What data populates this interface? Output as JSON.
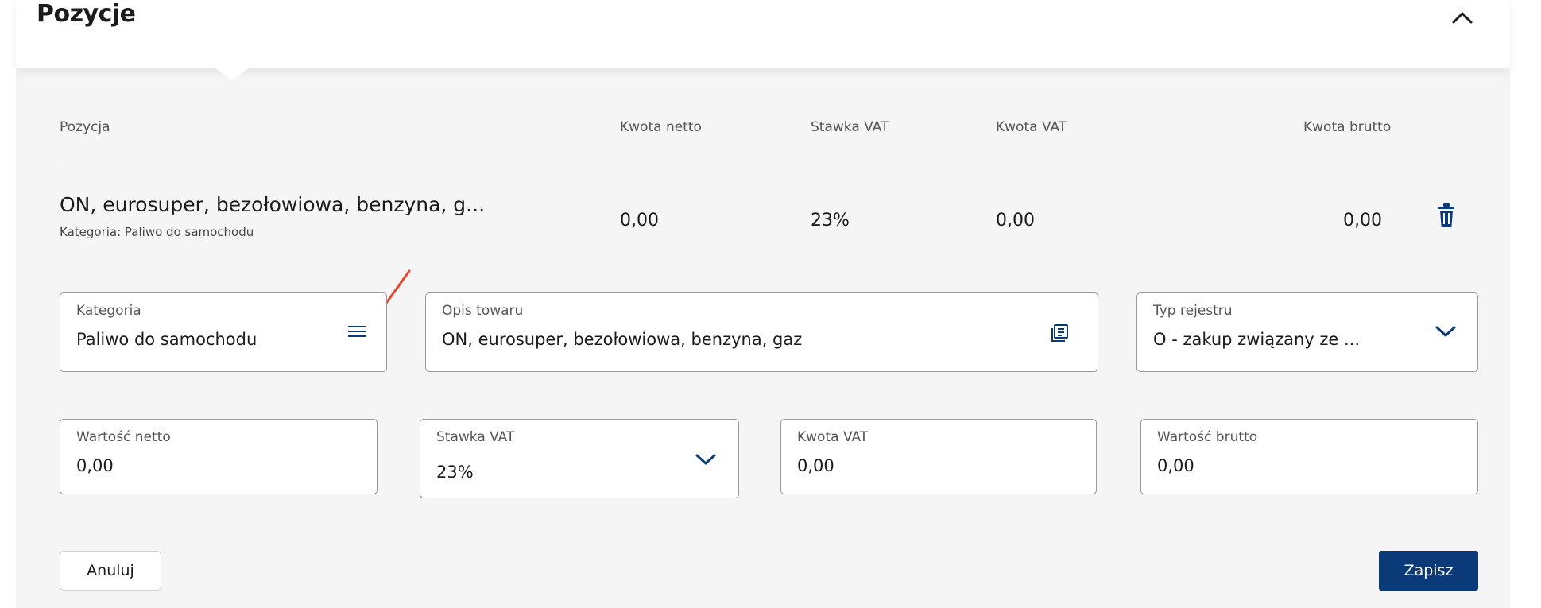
{
  "section": {
    "title": "Pozycje"
  },
  "table": {
    "headers": {
      "pozycja": "Pozycja",
      "kwota_netto": "Kwota netto",
      "stawka_vat": "Stawka VAT",
      "kwota_vat": "Kwota VAT",
      "kwota_brutto": "Kwota brutto"
    },
    "row": {
      "name": "ON, eurosuper, bezołowiowa, benzyna, g...",
      "category": "Kategoria: Paliwo do samochodu",
      "kwota_netto": "0,00",
      "stawka_vat": "23%",
      "kwota_vat": "0,00",
      "kwota_brutto": "0,00"
    }
  },
  "form": {
    "kategoria": {
      "label": "Kategoria",
      "value": "Paliwo do samochodu"
    },
    "opis_towaru": {
      "label": "Opis towaru",
      "value": "ON, eurosuper, bezołowiowa, benzyna, gaz"
    },
    "typ_rejestru": {
      "label": "Typ rejestru",
      "value": "O - zakup związany ze ..."
    },
    "wartosc_netto": {
      "label": "Wartość netto",
      "value": "0,00"
    },
    "stawka_vat": {
      "label": "Stawka VAT",
      "value": "23%"
    },
    "kwota_vat": {
      "label": "Kwota VAT",
      "value": "0,00"
    },
    "wartosc_brutto": {
      "label": "Wartość brutto",
      "value": "0,00"
    }
  },
  "actions": {
    "cancel_label": "Anuluj",
    "save_label": "Zapisz"
  },
  "icons": {
    "collapse": "chevron-up-icon",
    "delete": "trash-icon",
    "category_list": "menu-lines-icon",
    "description_dictionary": "dictionary-icon",
    "dropdown": "chevron-down-icon",
    "annotation": "red-arrow-icon"
  },
  "colors": {
    "primary": "#0a3a78",
    "accent_icon": "#0a3a78",
    "annotation": "#e8432c",
    "panel_bg": "#f5f5f5"
  }
}
